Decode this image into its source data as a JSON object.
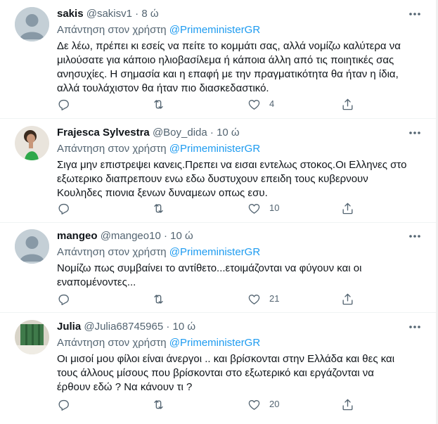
{
  "replying_prefix": "Απάντηση στον χρήστη ",
  "mention": "@PrimeministerGR",
  "tweets": [
    {
      "name": "sakis",
      "handle": "@sakisv1",
      "dot": "·",
      "time": "8 ώ",
      "body": "Δε λέω, πρέπει κι εσείς να πείτε το κομμάτι σας, αλλά νομίζω καλύτερα να\nμιλούσατε για κάποιο ηλιοβασίλεμα ή κάποια άλλη από τις ποιητικές σας\nανησυχίες. Η σημασία και η επαφή με την πραγματικότητα θα ήταν η ίδια,\nαλλά τουλάχιστον θα ήταν πιο διασκεδαστικό.",
      "likes": "4"
    },
    {
      "name": "Frajesca Sylvestra",
      "handle": "@Boy_dida",
      "dot": "·",
      "time": "10 ώ",
      "body": "Σιγα μην επιστρεψει κανεις.Πρεπει να εισαι εντελως στοκος.Οι Ελληνες στο\nεξωτερικο διαπρεπουν ενω εδω δυστυχουν επειδη τους κυβερνουν\nΚουληδες πιονια ξενων δυναμεων οπως εσυ.",
      "likes": "10"
    },
    {
      "name": "mangeo",
      "handle": "@mangeo10",
      "dot": "·",
      "time": "10 ώ",
      "body": "Νομίζω πως συμβαίνει το αντίθετο...ετοιμάζονται να φύγουν και οι\nεναπομένοντες...",
      "likes": "21"
    },
    {
      "name": "Julia",
      "handle": "@Julia68745965",
      "dot": "·",
      "time": "10 ώ",
      "body": "Οι μισοί μου φίλοι είναι άνεργοι .. και  βρίσκονται  στην Ελλάδα και θες και\nτους άλλους μίσους που βρίσκονται στο εξωτερικό και εργάζονται να\nέρθουν εδώ ? Να κάνουν τι ?",
      "likes": "20"
    }
  ],
  "colors": {
    "link": "#1d9bf0",
    "secondary": "#536471",
    "text": "#0f1419"
  }
}
